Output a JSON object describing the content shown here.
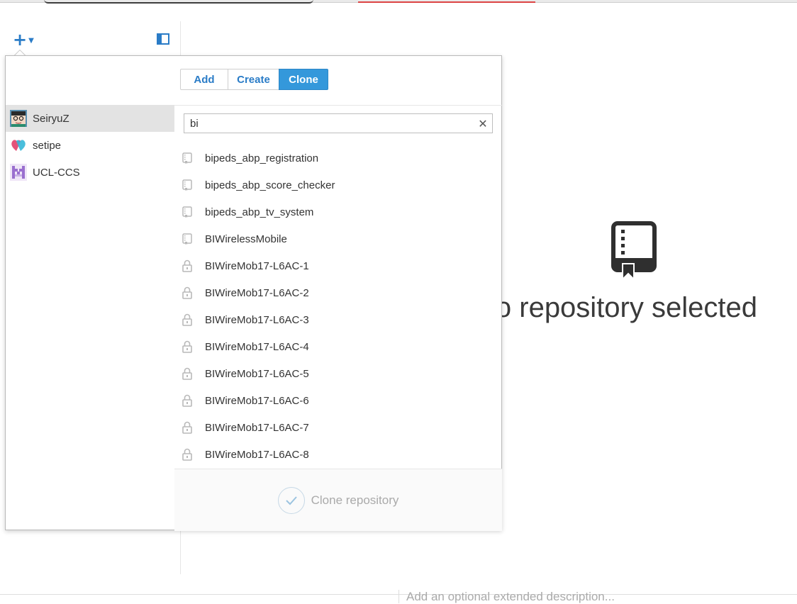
{
  "toolbar": {
    "add_icon": "plus-icon",
    "dropdown_icon": "chevron-down-icon",
    "panel_icon": "sidebar-toggle-icon"
  },
  "clone_dialog": {
    "tabs": [
      {
        "label": "Add"
      },
      {
        "label": "Create"
      },
      {
        "label": "Clone",
        "active": true
      }
    ],
    "accounts": [
      {
        "name": "SeiryuZ",
        "selected": true
      },
      {
        "name": "setipe"
      },
      {
        "name": "UCL-CCS"
      }
    ],
    "search": {
      "value": "bi"
    },
    "repos": [
      {
        "name": "bipeds_abp_registration",
        "icon": "repo-icon"
      },
      {
        "name": "bipeds_abp_score_checker",
        "icon": "repo-icon"
      },
      {
        "name": "bipeds_abp_tv_system",
        "icon": "repo-icon"
      },
      {
        "name": "BIWirelessMobile",
        "icon": "repo-icon"
      },
      {
        "name": "BIWireMob17-L6AC-1",
        "icon": "lock-icon"
      },
      {
        "name": "BIWireMob17-L6AC-2",
        "icon": "lock-icon"
      },
      {
        "name": "BIWireMob17-L6AC-3",
        "icon": "lock-icon"
      },
      {
        "name": "BIWireMob17-L6AC-4",
        "icon": "lock-icon"
      },
      {
        "name": "BIWireMob17-L6AC-5",
        "icon": "lock-icon"
      },
      {
        "name": "BIWireMob17-L6AC-6",
        "icon": "lock-icon"
      },
      {
        "name": "BIWireMob17-L6AC-7",
        "icon": "lock-icon"
      },
      {
        "name": "BIWireMob17-L6AC-8",
        "icon": "lock-icon"
      }
    ],
    "clone_button_label": "Clone repository"
  },
  "empty_state": {
    "text": "lo repository selected",
    "icon": "repo-book-icon"
  },
  "commit": {
    "description_placeholder": "Add an optional extended description..."
  },
  "colors": {
    "accent": "#2a7cc7",
    "active_tab": "#3498db",
    "selected_account": "#e3e3e3"
  }
}
